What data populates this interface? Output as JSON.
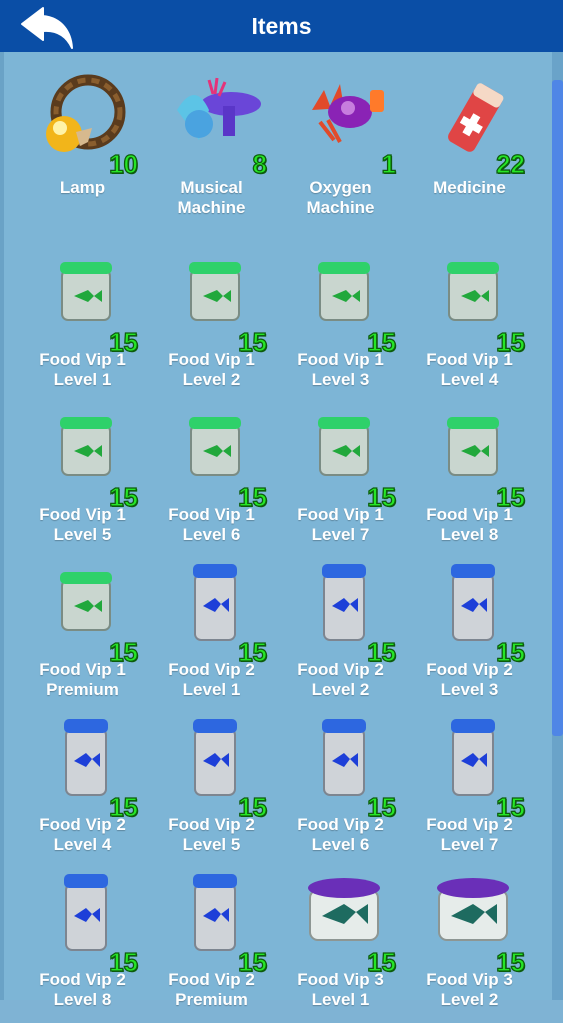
{
  "header": {
    "title": "Items"
  },
  "items": [
    {
      "name": "Lamp",
      "count": "10",
      "icon": "lamp-icon"
    },
    {
      "name": "Musical Machine",
      "count": "8",
      "icon": "musical-machine-icon"
    },
    {
      "name": "Oxygen Machine",
      "count": "1",
      "icon": "oxygen-machine-icon"
    },
    {
      "name": "Medicine",
      "count": "22",
      "icon": "medicine-icon"
    },
    {
      "name": "Food Vip 1 Level 1",
      "count": "15",
      "icon": "food-vip1-jar-icon"
    },
    {
      "name": "Food Vip 1 Level 2",
      "count": "15",
      "icon": "food-vip1-jar-icon"
    },
    {
      "name": "Food Vip 1 Level 3",
      "count": "15",
      "icon": "food-vip1-jar-icon"
    },
    {
      "name": "Food Vip 1 Level 4",
      "count": "15",
      "icon": "food-vip1-jar-icon"
    },
    {
      "name": "Food Vip 1 Level 5",
      "count": "15",
      "icon": "food-vip1-jar-icon"
    },
    {
      "name": "Food Vip 1 Level 6",
      "count": "15",
      "icon": "food-vip1-jar-icon"
    },
    {
      "name": "Food Vip 1 Level 7",
      "count": "15",
      "icon": "food-vip1-jar-icon"
    },
    {
      "name": "Food Vip 1 Level 8",
      "count": "15",
      "icon": "food-vip1-jar-icon"
    },
    {
      "name": "Food Vip 1 Premium",
      "count": "15",
      "icon": "food-vip1-jar-icon"
    },
    {
      "name": "Food Vip 2 Level 1",
      "count": "15",
      "icon": "food-vip2-jar-icon"
    },
    {
      "name": "Food Vip 2 Level 2",
      "count": "15",
      "icon": "food-vip2-jar-icon"
    },
    {
      "name": "Food Vip 2 Level 3",
      "count": "15",
      "icon": "food-vip2-jar-icon"
    },
    {
      "name": "Food Vip 2 Level 4",
      "count": "15",
      "icon": "food-vip2-jar-icon"
    },
    {
      "name": "Food Vip 2 Level 5",
      "count": "15",
      "icon": "food-vip2-jar-icon"
    },
    {
      "name": "Food Vip 2 Level 6",
      "count": "15",
      "icon": "food-vip2-jar-icon"
    },
    {
      "name": "Food Vip 2 Level 7",
      "count": "15",
      "icon": "food-vip2-jar-icon"
    },
    {
      "name": "Food Vip 2 Level 8",
      "count": "15",
      "icon": "food-vip2-jar-icon"
    },
    {
      "name": "Food Vip 2 Premium",
      "count": "15",
      "icon": "food-vip2-jar-icon"
    },
    {
      "name": "Food Vip 3 Level 1",
      "count": "15",
      "icon": "food-vip3-jar-icon"
    },
    {
      "name": "Food Vip 3 Level 2",
      "count": "15",
      "icon": "food-vip3-jar-icon"
    }
  ],
  "colors": {
    "header_bg": "#0a4ea6",
    "panel_bg": "#7db5d6",
    "count_green": "#26e626",
    "scroll_thumb": "#4f86e6"
  }
}
